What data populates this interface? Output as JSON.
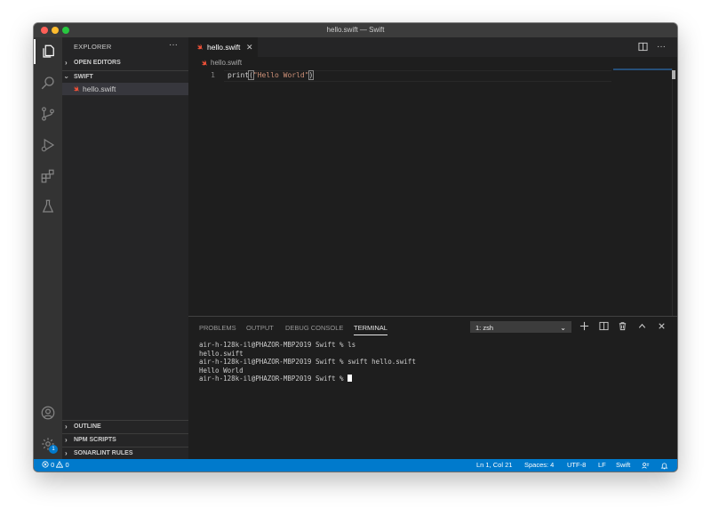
{
  "window": {
    "title": "hello.swift — Swift"
  },
  "sidebar": {
    "title": "EXPLORER",
    "more": "···",
    "open_editors": "OPEN EDITORS",
    "folder": "SWIFT",
    "files": [
      "hello.swift"
    ],
    "outline": "OUTLINE",
    "npm_scripts": "NPM SCRIPTS",
    "sonarlint": "SONARLINT RULES"
  },
  "activity": {
    "settings_badge": "1"
  },
  "editor": {
    "tab": {
      "label": "hello.swift",
      "close": "✕"
    },
    "breadcrumb": "hello.swift",
    "line_number": "1",
    "code": {
      "fn": "print",
      "open": "(",
      "string": "\"Hello World\"",
      "close": ")"
    }
  },
  "panel": {
    "tabs": [
      "PROBLEMS",
      "OUTPUT",
      "DEBUG CONSOLE",
      "TERMINAL"
    ],
    "active_tab": "TERMINAL",
    "terminal_select": "1: zsh",
    "terminal_lines": [
      "air-h-128k-il@PHAZOR-MBP2019 Swift % ls",
      "hello.swift",
      "air-h-128k-il@PHAZOR-MBP2019 Swift % swift hello.swift",
      "Hello World",
      "air-h-128k-il@PHAZOR-MBP2019 Swift % "
    ]
  },
  "status": {
    "errors": "0",
    "warnings": "0",
    "position": "Ln 1, Col 21",
    "spaces": "Spaces: 4",
    "encoding": "UTF-8",
    "eol": "LF",
    "language": "Swift"
  },
  "colors": {
    "accent": "#007acc",
    "swift": "#f05138",
    "string": "#ce9178"
  }
}
